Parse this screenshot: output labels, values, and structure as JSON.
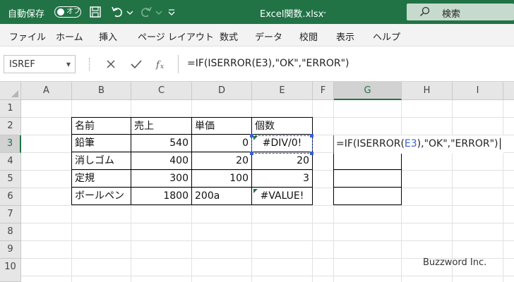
{
  "titlebar": {
    "autosave_label": "自動保存",
    "autosave_state": "オフ",
    "doc_title": "Excel関数.xlsx",
    "doc_caret": "⌄",
    "search_placeholder": "検索",
    "bg_color": "#217346"
  },
  "ribbon": {
    "tabs": [
      "ファイル",
      "ホーム",
      "挿入",
      "ページ レイアウト",
      "数式",
      "データ",
      "校閲",
      "表示",
      "ヘルプ"
    ]
  },
  "formula_bar": {
    "name_box": "ISREF",
    "formula": "=IF(ISERROR(E3),\"OK\",\"ERROR\")"
  },
  "grid": {
    "columns": [
      "A",
      "B",
      "C",
      "D",
      "E",
      "F",
      "G",
      "H",
      "I"
    ],
    "rows": [
      "1",
      "2",
      "3",
      "4",
      "5",
      "6",
      "7",
      "8",
      "9",
      "10"
    ],
    "selected_column": "G",
    "selected_row": "3"
  },
  "table": {
    "headers": [
      "名前",
      "売上",
      "単価",
      "個数"
    ],
    "rows": [
      [
        "鉛筆",
        "540",
        "0",
        "#DIV/0!"
      ],
      [
        "消しゴム",
        "400",
        "20",
        "20"
      ],
      [
        "定規",
        "300",
        "100",
        "3"
      ],
      [
        "ボールペン",
        "1800",
        "200a",
        "#VALUE!"
      ]
    ]
  },
  "editing": {
    "prefix": "=IF(ISERROR(",
    "ref": "E3",
    "suffix": "),\"OK\",\"ERROR\")"
  },
  "watermark": "Buzzword Inc.",
  "colors": {
    "accent": "#217346",
    "reference": "#3a5fcd"
  }
}
